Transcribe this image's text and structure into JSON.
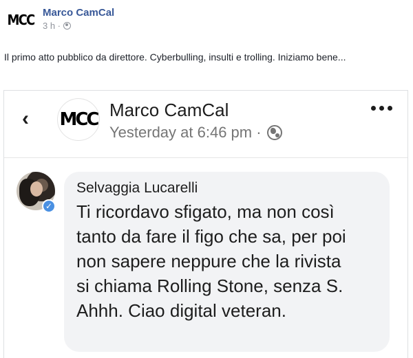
{
  "post": {
    "logo_text": "MCC",
    "author": "Marco CamCal",
    "time": "3 h ·",
    "text": "Il primo atto pubblico da direttore. Cyberbulling, insulti e trolling. Iniziamo bene..."
  },
  "embedded": {
    "back_icon": "chevron-left-icon",
    "logo_text": "MCC",
    "name": "Marco CamCal",
    "time": "Yesterday at 6:46 pm ·",
    "comment": {
      "author": "Selvaggia Lucarelli",
      "text": "Ti ricordavo sfigato, ma non così tanto da fare il figo che sa, per poi non sapere neppure che la rivista si chiama Rolling Stone, senza S. Ahhh. Ciao digital veteran."
    }
  },
  "colors": {
    "link": "#385898",
    "bubble": "#f2f3f5",
    "verified": "#4a90e2"
  }
}
